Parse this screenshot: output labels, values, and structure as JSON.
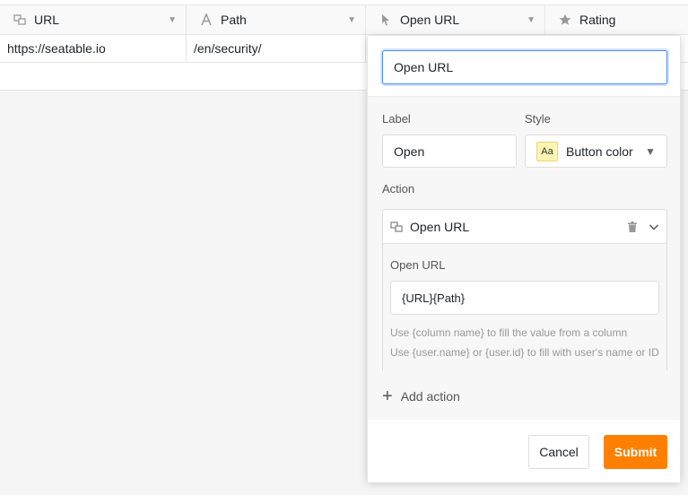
{
  "columns": [
    {
      "label": "URL",
      "icon": "url-column-icon"
    },
    {
      "label": "Path",
      "icon": "text-column-icon"
    },
    {
      "label": "Open URL",
      "icon": "button-column-icon"
    },
    {
      "label": "Rating",
      "icon": "star-icon"
    }
  ],
  "row": {
    "url": "https://seatable.io",
    "path": "/en/security/"
  },
  "popover": {
    "column_name_value": "Open URL",
    "label_field": {
      "label": "Label",
      "value": "Open"
    },
    "style_field": {
      "label": "Style",
      "badge": "Aa",
      "value": "Button color"
    },
    "action_section": {
      "label": "Action",
      "action_title": "Open URL",
      "body_label": "Open URL",
      "url_value": "{URL}{Path}",
      "hint_1": "Use {column name} to fill the value from a column",
      "hint_2": "Use {user.name} or {user.id} to fill with user's name or ID"
    },
    "add_action_label": "Add action",
    "cancel_label": "Cancel",
    "submit_label": "Submit"
  },
  "colors": {
    "accent": "#ff8000",
    "focus": "#4c8ff0"
  }
}
